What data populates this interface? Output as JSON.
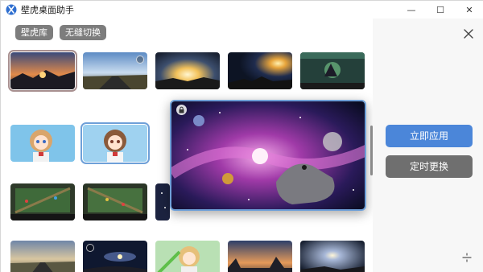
{
  "app": {
    "title": "壁虎桌面助手"
  },
  "window_controls": {
    "minimize": "—",
    "maximize": "☐",
    "close": "✕"
  },
  "tabs": [
    {
      "label": "壁虎库"
    },
    {
      "label": "无缝切换"
    }
  ],
  "actions": {
    "apply_label": "立即应用",
    "timer_label": "定时更换"
  },
  "colors": {
    "accent": "#4b86d9",
    "button_gray": "#6f6f6f",
    "tab_gray": "#7d7d7d"
  },
  "gallery": [
    {
      "row": 1,
      "items": [
        "sunset-mountain",
        "road-sunrise",
        "sunburst-rays",
        "night-burst",
        "game-battle"
      ]
    },
    {
      "row": 2,
      "items": [
        "anime-girl-1",
        "anime-girl-2",
        "moba-map-1",
        "moba-map-2",
        "starry-partial"
      ]
    },
    {
      "row": 3,
      "items": [
        "road-dusk",
        "galaxy-planet",
        "anime-girl-3",
        "desert-sunset",
        "night-glow"
      ]
    }
  ],
  "preview": {
    "subject": "cosmic-lizard-galaxy"
  }
}
